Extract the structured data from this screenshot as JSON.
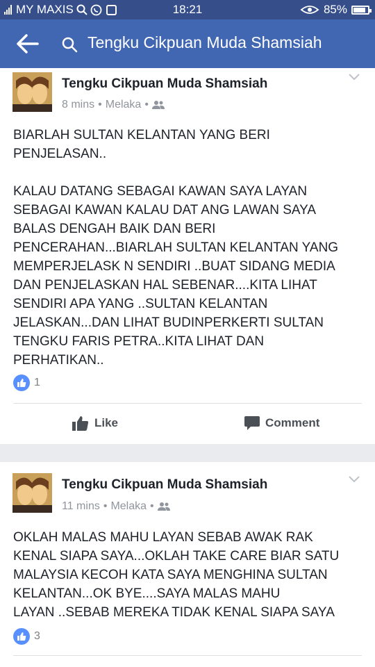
{
  "status_bar": {
    "carrier": "MY MAXIS",
    "time": "18:21",
    "battery": "85%"
  },
  "search": {
    "query": "Tengku Cikpuan Muda Shamsiah"
  },
  "posts": [
    {
      "author": "Tengku Cikpuan Muda Shamsiah",
      "time": "8 mins",
      "location": "Melaka",
      "separator": "•",
      "text": "BIARLAH SULTAN KELANTAN YANG BERI\nPENJELASAN..\n\nKALAU DATANG SEBAGAI KAWAN SAYA LAYAN\nSEBAGAI KAWAN KALAU DAT ANG LAWAN SAYA\nBALAS DENGAH BAIK DAN BERI\nPENCERAHAN...BIARLAH SULTAN KELANTAN YANG\nMEMPERJELASK N SENDIRI ..BUAT SIDANG MEDIA\nDAN PENJELASKAN HAL SEBENAR....KITA LIHAT\nSENDIRI APA YANG ..SULTAN KELANTAN\nJELASKAN...DAN LIHAT BUDINPERKERTI SULTAN\nTENGKU FARIS PETRA..KITA LIHAT DAN\nPERHATIKAN..",
      "likes": "1",
      "like_label": "Like",
      "comment_label": "Comment"
    },
    {
      "author": "Tengku Cikpuan Muda Shamsiah",
      "time": "11 mins",
      "location": "Melaka",
      "separator": "•",
      "text": "OKLAH MALAS MAHU LAYAN SEBAB AWAK RAK\nKENAL SIAPA  SAYA...OKLAH TAKE CARE BIAR SATU\nMALAYSIA KECOH KATA SAYA MENGHINA SULTAN\nKELANTAN...OK BYE....SAYA MALAS MAHU\nLAYAN ..SEBAB MEREKA TIDAK KENAL SIAPA SAYA",
      "likes": "3"
    }
  ],
  "colors": {
    "status_bar": "#364f8b",
    "header": "#4267b2",
    "like_badge": "#5890ff"
  },
  "icons": [
    "signal-icon",
    "search-icon",
    "whatsapp-icon",
    "download-icon",
    "eye-icon",
    "battery-icon",
    "back-arrow-icon",
    "chevron-down-icon",
    "friends-icon",
    "like-thumb-icon",
    "comment-icon"
  ]
}
